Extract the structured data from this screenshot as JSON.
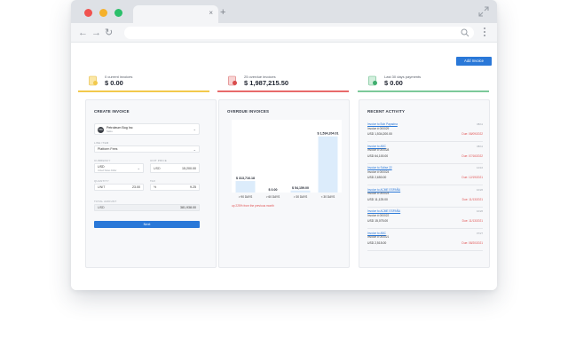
{
  "browser": {
    "tab_close": "×",
    "new_tab": "+",
    "back": "←",
    "forward": "→",
    "reload": "↻"
  },
  "toolbar": {
    "add_invoice": "Add Invoice"
  },
  "stats": [
    {
      "label": "0 current invoices",
      "value": "$ 0.00",
      "color": "#f2c94c",
      "icon": "invoice-clock-icon"
    },
    {
      "label": "25 overdue invoices",
      "value": "$ 1,987,215.50",
      "color": "#e86a6a",
      "icon": "invoice-alert-icon"
    },
    {
      "label": "Last 30 days payments",
      "value": "$ 0.00",
      "color": "#7cc99a",
      "icon": "invoice-check-icon"
    }
  ],
  "create_invoice": {
    "title": "CREATE INVOICE",
    "client_initials": "PBI",
    "client_name": "Petroleum Bog Inc",
    "client_sub": "Nakia",
    "line_item_label": "LINE ITEM",
    "line_item_value": "Platform Fees",
    "currency_label": "CURRENCY",
    "currency_value": "USD",
    "currency_sub": "United States Dollar",
    "unit_price_label": "UNIT PRICE",
    "unit_price_currency": "USD",
    "unit_price_value": "15,200.00",
    "quantity_label": "QUANTITY",
    "quantity_unit": "UNIT",
    "quantity_value": "23.00",
    "tax_label": "TAX",
    "tax_value": "9.25",
    "tax_unit": "%",
    "total_label": "TOTAL AMOUNT",
    "total_currency": "USD",
    "total_value": "381,938.00",
    "next_label": "Next"
  },
  "overdue": {
    "title": "OVERDUE INVOICES",
    "note": "up 225% from the previous month"
  },
  "chart_data": {
    "type": "bar",
    "categories": [
      "> 90 DAYS",
      "> 60 DAYS",
      "> 30 DAYS",
      "< 30 DAYS"
    ],
    "values": [
      313716.18,
      0,
      54159.0,
      1534204.01
    ],
    "value_labels": [
      "$ 313,716.18",
      "$ 0.00",
      "$ 54,159.00",
      "$ 1,534,204.01"
    ],
    "ylim": [
      0,
      1600000
    ],
    "bar_color": "#dcecfb",
    "grid": false,
    "title": "",
    "xlabel": "",
    "ylabel": ""
  },
  "recent": {
    "title": "RECENT ACTIVITY",
    "items": [
      {
        "link": "Invoice to Bob Papadna",
        "number": "Invoice # 000029",
        "time": "08/11",
        "amount": "USD 1,534,200.00",
        "due": "Due: 08/09/2022"
      },
      {
        "link": "Invoice to ABC",
        "number": "Invoice # 000028",
        "time": "08/11",
        "amount": "USD 64,100.00",
        "due": "Due: 07/16/2022"
      },
      {
        "link": "Invoice to Solise 22",
        "number": "Invoice # 000024",
        "time": "12/16",
        "amount": "USD 2,650.00",
        "due": "Due: 12/19/2021"
      },
      {
        "link": "Invoice to ACME ESPAÑA",
        "number": "Invoice # 000023",
        "time": "10/26",
        "amount": "USD 11,125.00",
        "due": "Due: 11/13/2021"
      },
      {
        "link": "Invoice to ACME ESPAÑA",
        "number": "Invoice # 000022",
        "time": "10/26",
        "amount": "USD 15,075.00",
        "due": "Due: 11/13/2021"
      },
      {
        "link": "Invoice to ABC",
        "number": "Invoice # 000021",
        "time": "07/27",
        "amount": "USD 2,515.00",
        "due": "Due: 08/20/2021"
      }
    ]
  }
}
